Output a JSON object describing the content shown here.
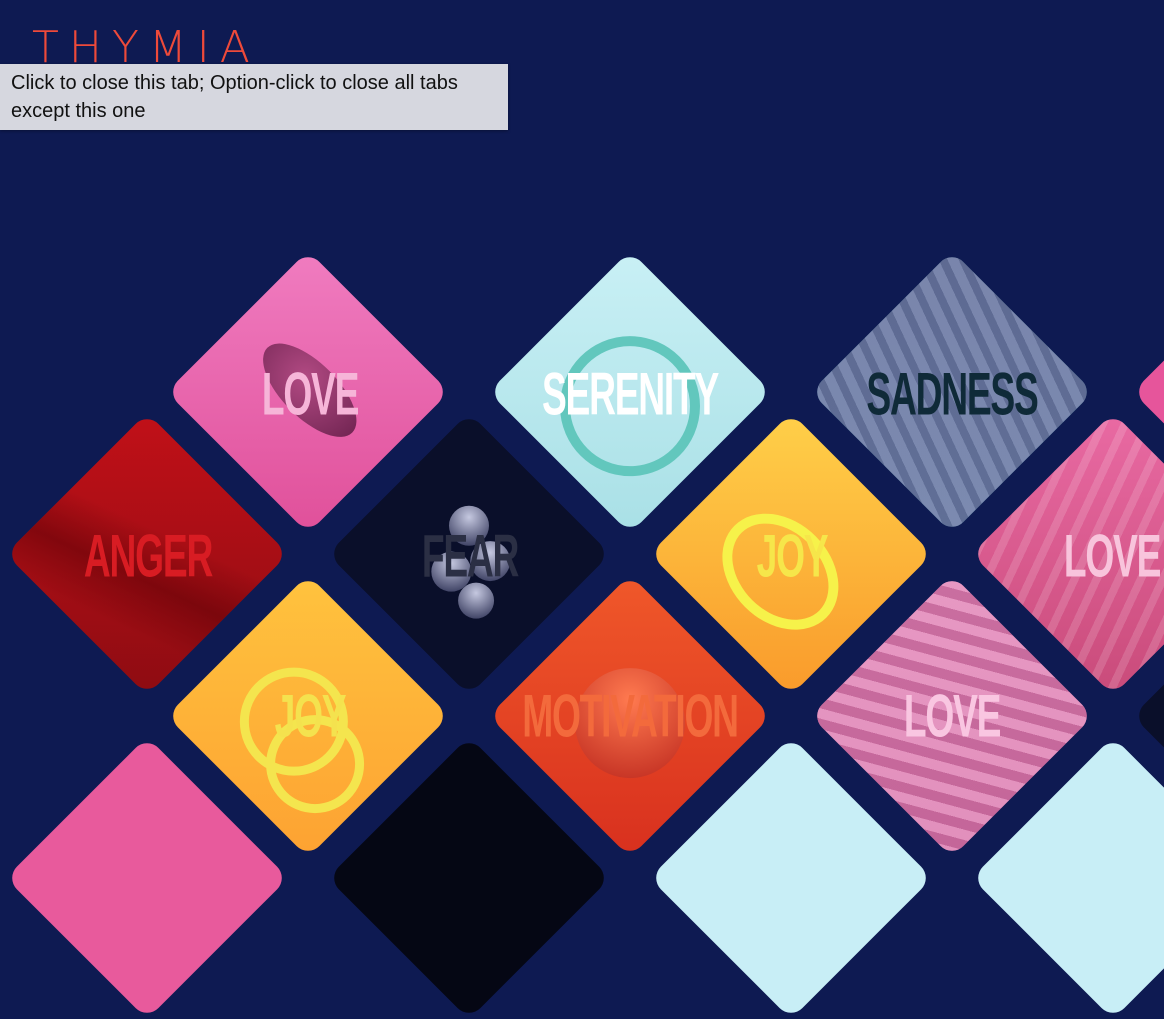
{
  "logo": {
    "text": "THYMIA"
  },
  "tooltip": {
    "text": "Click to close this tab; Option-click to close all tabs except this one"
  },
  "tiles": [
    {
      "label": "LOVE",
      "bg": "#ee6fb6",
      "color": "#f6b5d8"
    },
    {
      "label": "SERENITY",
      "bg": "#bfeaf0",
      "color": "#ffffff"
    },
    {
      "label": "SADNESS",
      "bg": "#4e5c8f",
      "color": "#0f2a38"
    },
    {
      "label": "ANGER",
      "bg": "#b3121a",
      "color": "#d81c23"
    },
    {
      "label": "FEAR",
      "bg": "#0c1230",
      "color": "#2b2f44"
    },
    {
      "label": "JOY",
      "bg": "#fcb23a",
      "color": "#f6e64a"
    },
    {
      "label": "LOVE",
      "bg": "#e06496",
      "color": "#f8c4dc"
    },
    {
      "label": "JOY",
      "bg": "#fdb540",
      "color": "#f4e24e"
    },
    {
      "label": "MOTIVATION",
      "bg": "#e83a26",
      "color": "#f36a3c"
    },
    {
      "label": "LOVE",
      "bg": "#d472a8",
      "color": "#f9c6e1"
    }
  ]
}
